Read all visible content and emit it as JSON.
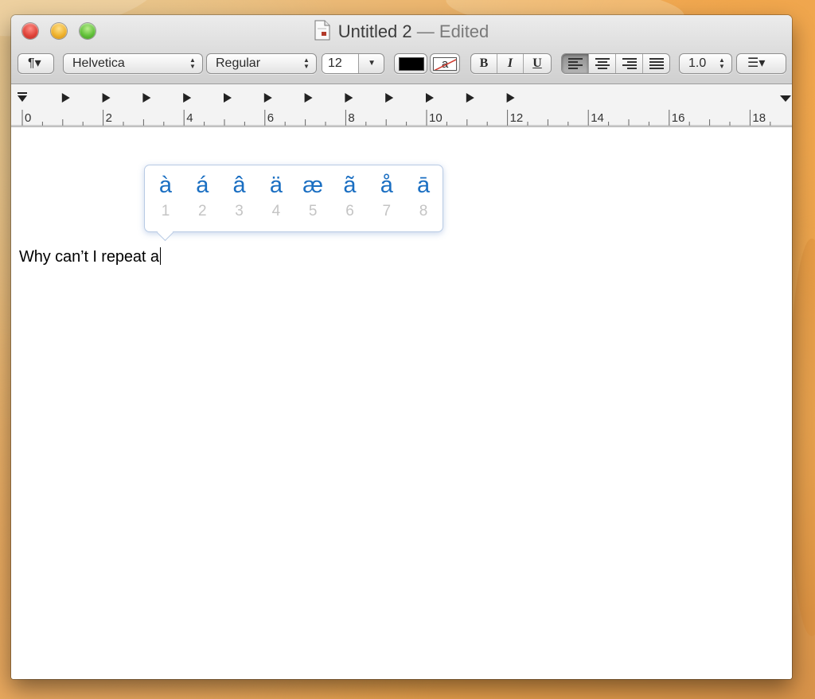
{
  "window": {
    "title": "Untitled 2",
    "edited": "— Edited"
  },
  "toolbar": {
    "paragraph_label": "¶▾",
    "font_family": "Helvetica",
    "font_style": "Regular",
    "font_size": "12",
    "text_color": "#000000",
    "highlight_label": "a",
    "bold_label": "B",
    "italic_label": "I",
    "underline_label": "U",
    "line_spacing": "1.0",
    "list_label": "☰▾",
    "alignment_selected": "left"
  },
  "ruler": {
    "labels": [
      "0",
      "2",
      "4",
      "6",
      "8",
      "10",
      "12",
      "14",
      "16",
      "18"
    ]
  },
  "document": {
    "text": "Why can’t I repeat a"
  },
  "accent_popover": {
    "options": [
      {
        "char": "à",
        "key": "1"
      },
      {
        "char": "á",
        "key": "2"
      },
      {
        "char": "â",
        "key": "3"
      },
      {
        "char": "ä",
        "key": "4"
      },
      {
        "char": "æ",
        "key": "5"
      },
      {
        "char": "ã",
        "key": "6"
      },
      {
        "char": "å",
        "key": "7"
      },
      {
        "char": "ā",
        "key": "8"
      }
    ]
  },
  "colors": {
    "accent_char": "#1b6fc2",
    "accent_key": "#c4c4c4"
  }
}
